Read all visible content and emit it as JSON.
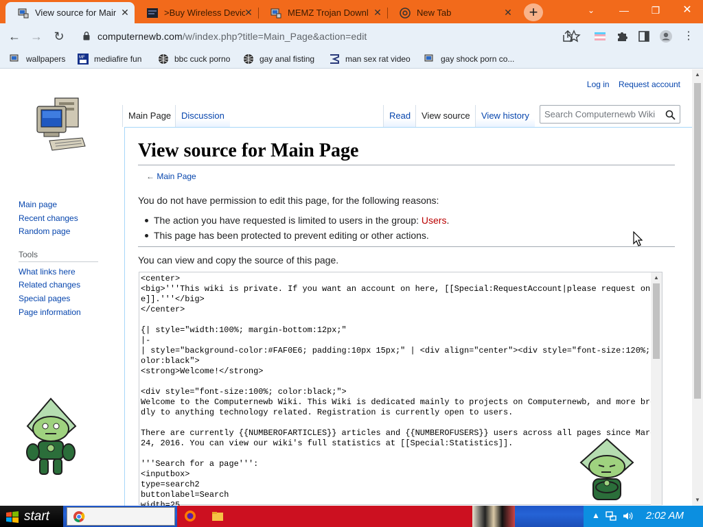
{
  "colors": {
    "accent": "#f26a1b",
    "link": "#0645ad",
    "red_link": "#ba0000",
    "taskbar": "#1f57c8"
  },
  "tabs": [
    {
      "title": "View source for Main Page",
      "icon": "monitor-icon",
      "active": true
    },
    {
      "title": ">Buy Wireless Devices",
      "icon": "blackbox-icon",
      "active": false
    },
    {
      "title": "MEMZ Trojan Download",
      "icon": "monitor-icon",
      "active": false
    },
    {
      "title": "New Tab",
      "icon": "chrome-icon",
      "active": false
    }
  ],
  "omnibox": {
    "host": "computernewb.com",
    "path": "/w/index.php?title=Main_Page&action=edit"
  },
  "bookmarks": [
    {
      "label": "wallpapers",
      "icon": "monitor-icon"
    },
    {
      "label": "mediafire fun",
      "icon": "mediafire-icon"
    },
    {
      "label": "bbc cuck porno",
      "icon": "globe-icon"
    },
    {
      "label": "gay anal fisting",
      "icon": "globe-icon"
    },
    {
      "label": "man sex rat video",
      "icon": "sigma-icon"
    },
    {
      "label": "gay shock porn co...",
      "icon": "monitor-icon"
    }
  ],
  "personal": {
    "login": "Log in",
    "request": "Request account"
  },
  "sidebar": {
    "nav": [
      "Main page",
      "Recent changes",
      "Random page"
    ],
    "tools_heading": "Tools",
    "tools": [
      "What links here",
      "Related changes",
      "Special pages",
      "Page information"
    ]
  },
  "content_tabs": {
    "main": "Main Page",
    "discussion": "Discussion",
    "read": "Read",
    "view_source": "View source",
    "history": "View history"
  },
  "search": {
    "placeholder": "Search Computernewb Wiki"
  },
  "page": {
    "title": "View source for Main Page",
    "backlink_arrow": "←",
    "backlink": "Main Page",
    "permission": "You do not have permission to edit this page, for the following reasons:",
    "reason1_pre": "The action you have requested is limited to users in the group: ",
    "reason1_link": "Users",
    "reason1_post": ".",
    "reason2": "This page has been protected to prevent editing or other actions.",
    "copy_note": "You can view and copy the source of this page.",
    "source": "<center>\n<big>'''This wiki is private. If you want an account on here, [[Special:RequestAccount|please request one]].'''</big>\n</center>\n\n{| style=\"width:100%; margin-bottom:12px;\"\n|-\n| style=\"background-color:#FAF0E6; padding:10px 15px;\" | <div align=\"center\"><div style=\"font-size:120%; color:black\">\n<strong>Welcome!</strong>\n\n<div style=\"font-size:100%; color:black;\">\nWelcome to the Computernewb Wiki. This Wiki is dedicated mainly to projects on Computernewb, and more broadly to anything technology related. Registration is currently open to users.\n\nThere are currently {{NUMBEROFARTICLES}} articles and {{NUMBEROFUSERS}} users across all pages since March 24, 2016. You can view our wiki's full statistics at [[Special:Statistics]].\n\n'''Search for a page''':\n<inputbox>\ntype=search2\nbuttonlabel=Search\nwidth=25"
  },
  "taskbar": {
    "start": "start",
    "clock": "2:02 AM"
  }
}
